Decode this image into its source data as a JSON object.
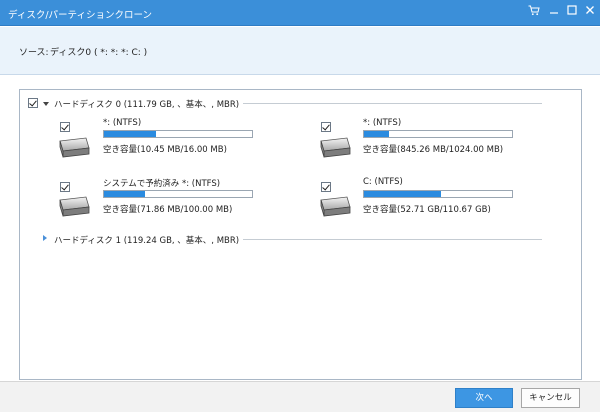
{
  "window": {
    "title": "ディスク/パーティションクローン",
    "controls": {
      "cart": "cart-icon",
      "minimize": "minimize-icon",
      "maximize": "maximize-icon",
      "close": "close-icon"
    }
  },
  "source": {
    "label": "ソース:",
    "value": "ディスク0 ( *: *: *: C: )"
  },
  "disks": [
    {
      "header": "ハードディスク 0 (111.79 GB, 、基本、, MBR)",
      "checked": true,
      "expanded": true,
      "partitions": [
        {
          "name": "*: (NTFS)",
          "capacity": "空き容量(10.45 MB/16.00 MB)",
          "used_fraction": 0.35,
          "checked": true
        },
        {
          "name": "*: (NTFS)",
          "capacity": "空き容量(845.26 MB/1024.00 MB)",
          "used_fraction": 0.17,
          "checked": true
        },
        {
          "name": "システムで予約済み *: (NTFS)",
          "capacity": "空き容量(71.86 MB/100.00 MB)",
          "used_fraction": 0.28,
          "checked": true
        },
        {
          "name": "C: (NTFS)",
          "capacity": "空き容量(52.71 GB/110.67 GB)",
          "used_fraction": 0.52,
          "checked": true
        }
      ]
    },
    {
      "header": "ハードディスク 1 (119.24 GB, 、基本、, MBR)",
      "checked": false,
      "expanded": false
    }
  ],
  "buttons": {
    "next": "次へ",
    "cancel": "キャンセル"
  },
  "colors": {
    "titlebar": "#3b8fd9",
    "accent": "#2a8be0",
    "source_bg": "#eaf3fb"
  }
}
